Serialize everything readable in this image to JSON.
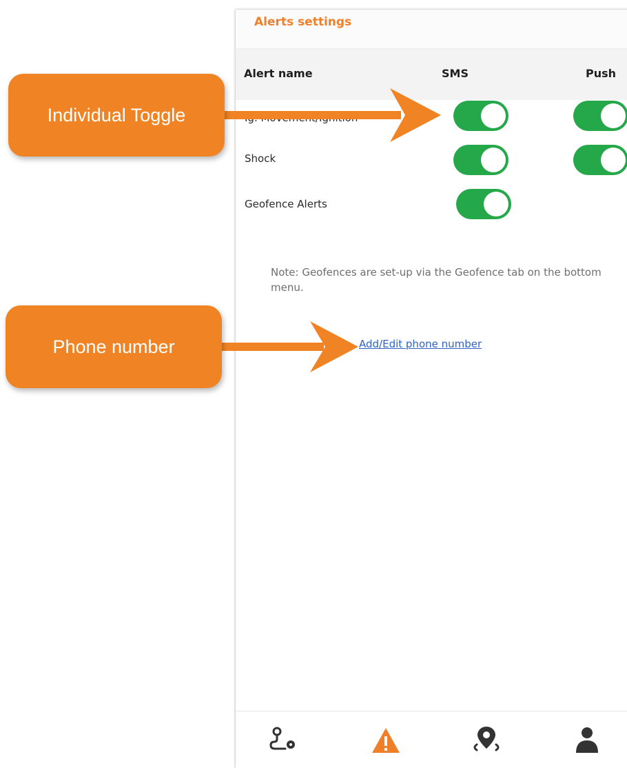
{
  "header": {
    "title": "Alerts settings"
  },
  "columns": {
    "name": "Alert name",
    "sms": "SMS",
    "push": "Push"
  },
  "alerts": [
    {
      "label": "Ig. Movement/Ignition",
      "sms": true,
      "push": true
    },
    {
      "label": "Shock",
      "sms": true,
      "push": true
    },
    {
      "label": "Geofence Alerts",
      "sms": true,
      "push": null
    }
  ],
  "note": "Note: Geofences are set-up via the Geofence tab on the bottom menu.",
  "phone_link": "Add/Edit phone number",
  "nav": [
    "route-icon",
    "warning-icon",
    "location-pin-icon",
    "user-icon"
  ],
  "callouts": {
    "toggle": "Individual Toggle",
    "phone": "Phone number"
  },
  "colors": {
    "accent": "#f07f2a",
    "toggle_on": "#25a849",
    "link": "#2e62c8",
    "callout": "#f08424"
  }
}
